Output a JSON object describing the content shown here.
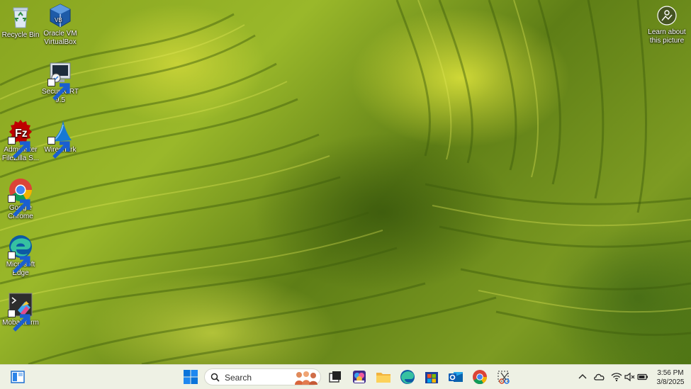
{
  "desktop": {
    "icons": [
      {
        "label": "Recycle Bin"
      },
      {
        "label": "Oracle VM VirtualBox"
      },
      {
        "label": "SecureCRT 9.5"
      },
      {
        "label": "Administer FileZilla S..."
      },
      {
        "label": "Wireshark"
      },
      {
        "label": "Google Chrome"
      },
      {
        "label": "Microsoft Edge"
      },
      {
        "label": "MobaXterm"
      }
    ],
    "learn_label": "Learn about this picture"
  },
  "taskbar": {
    "search_placeholder": "Search",
    "pinned": [
      "widgets-icon",
      "start-icon",
      "task-view-icon",
      "copilot-icon",
      "file-explorer-icon",
      "edge-icon",
      "store-icon",
      "outlook-icon",
      "chrome-icon",
      "snipping-tool-icon"
    ],
    "accent": "#0067c0"
  },
  "tray": {
    "time": "3:56 PM",
    "date": "3/8/2025"
  }
}
